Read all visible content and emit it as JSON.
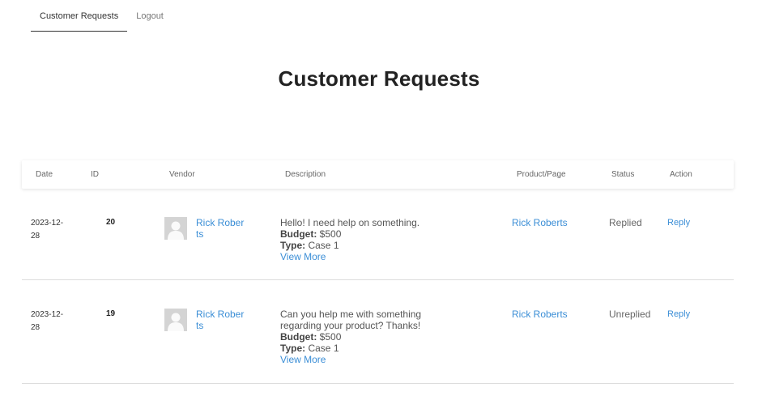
{
  "nav": {
    "tabs": [
      {
        "label": "Customer Requests"
      },
      {
        "label": "Logout"
      }
    ]
  },
  "page_title": "Customer Requests",
  "table": {
    "headers": [
      "Date",
      "ID",
      "Vendor",
      "Description",
      "Product/Page",
      "Status",
      "Action"
    ],
    "rows": [
      {
        "date_line1": "2023-12-",
        "date_line2": "28",
        "id": "20",
        "vendor": "Rick Roberts",
        "description": "Hello! I need help on something.",
        "budget_label": "Budget:",
        "budget": "$500",
        "type_label": "Type:",
        "type": "Case 1",
        "view_more": "View More",
        "product_page": "Rick Roberts",
        "status": "Replied",
        "action": "Reply"
      },
      {
        "date_line1": "2023-12-",
        "date_line2": "28",
        "id": "19",
        "vendor": "Rick Roberts",
        "description": "Can you help me with something regarding your product? Thanks!",
        "budget_label": "Budget:",
        "budget": "$500",
        "type_label": "Type:",
        "type": "Case 1",
        "view_more": "View More",
        "product_page": "Rick Roberts",
        "status": "Unreplied",
        "action": "Reply"
      }
    ]
  }
}
